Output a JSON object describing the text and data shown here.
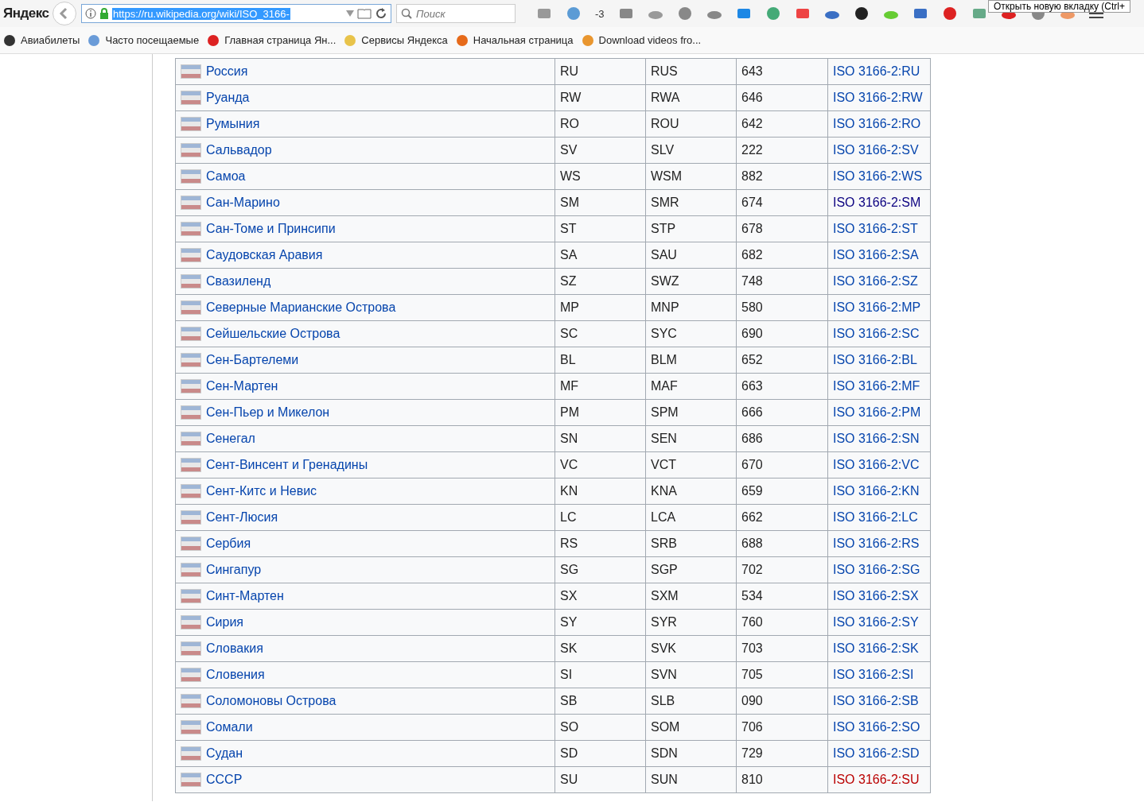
{
  "browser": {
    "logo": "Яндекс",
    "url": "https://ru.wikipedia.org/wiki/ISO_3166-",
    "search": {
      "placeholder": "Поиск"
    },
    "weather_badge": "-3",
    "tooltip": "Открыть новую вкладку (Ctrl+"
  },
  "bookmarks": [
    {
      "label": "Авиабилеты"
    },
    {
      "label": "Часто посещаемые"
    },
    {
      "label": "Главная страница Ян..."
    },
    {
      "label": "Сервисы Яндекса"
    },
    {
      "label": "Начальная страница"
    },
    {
      "label": "Download videos fro..."
    }
  ],
  "table": {
    "rows": [
      {
        "name": "Россия",
        "alpha2": "RU",
        "alpha3": "RUS",
        "numeric": "643",
        "iso": "ISO 3166-2:RU",
        "kind": "link"
      },
      {
        "name": "Руанда",
        "alpha2": "RW",
        "alpha3": "RWA",
        "numeric": "646",
        "iso": "ISO 3166-2:RW",
        "kind": "link"
      },
      {
        "name": "Румыния",
        "alpha2": "RO",
        "alpha3": "ROU",
        "numeric": "642",
        "iso": "ISO 3166-2:RO",
        "kind": "link"
      },
      {
        "name": "Сальвадор",
        "alpha2": "SV",
        "alpha3": "SLV",
        "numeric": "222",
        "iso": "ISO 3166-2:SV",
        "kind": "link"
      },
      {
        "name": "Самоа",
        "alpha2": "WS",
        "alpha3": "WSM",
        "numeric": "882",
        "iso": "ISO 3166-2:WS",
        "kind": "link"
      },
      {
        "name": "Сан-Марино",
        "alpha2": "SM",
        "alpha3": "SMR",
        "numeric": "674",
        "iso": "ISO 3166-2:SM",
        "kind": "visited"
      },
      {
        "name": "Сан-Томе и Принсипи",
        "alpha2": "ST",
        "alpha3": "STP",
        "numeric": "678",
        "iso": "ISO 3166-2:ST",
        "kind": "link"
      },
      {
        "name": "Саудовская Аравия",
        "alpha2": "SA",
        "alpha3": "SAU",
        "numeric": "682",
        "iso": "ISO 3166-2:SA",
        "kind": "link"
      },
      {
        "name": "Свазиленд",
        "alpha2": "SZ",
        "alpha3": "SWZ",
        "numeric": "748",
        "iso": "ISO 3166-2:SZ",
        "kind": "link"
      },
      {
        "name": "Северные Марианские Острова",
        "alpha2": "MP",
        "alpha3": "MNP",
        "numeric": "580",
        "iso": "ISO 3166-2:MP",
        "kind": "link"
      },
      {
        "name": "Сейшельские Острова",
        "alpha2": "SC",
        "alpha3": "SYC",
        "numeric": "690",
        "iso": "ISO 3166-2:SC",
        "kind": "link"
      },
      {
        "name": "Сен-Бартелеми",
        "alpha2": "BL",
        "alpha3": "BLM",
        "numeric": "652",
        "iso": "ISO 3166-2:BL",
        "kind": "link"
      },
      {
        "name": "Сен-Мартен",
        "alpha2": "MF",
        "alpha3": "MAF",
        "numeric": "663",
        "iso": "ISO 3166-2:MF",
        "kind": "link"
      },
      {
        "name": "Сен-Пьер и Микелон",
        "alpha2": "PM",
        "alpha3": "SPM",
        "numeric": "666",
        "iso": "ISO 3166-2:PM",
        "kind": "link"
      },
      {
        "name": "Сенегал",
        "alpha2": "SN",
        "alpha3": "SEN",
        "numeric": "686",
        "iso": "ISO 3166-2:SN",
        "kind": "link"
      },
      {
        "name": "Сент-Винсент и Гренадины",
        "alpha2": "VC",
        "alpha3": "VCT",
        "numeric": "670",
        "iso": "ISO 3166-2:VC",
        "kind": "link"
      },
      {
        "name": "Сент-Китс и Невис",
        "alpha2": "KN",
        "alpha3": "KNA",
        "numeric": "659",
        "iso": "ISO 3166-2:KN",
        "kind": "link"
      },
      {
        "name": "Сент-Люсия",
        "alpha2": "LC",
        "alpha3": "LCA",
        "numeric": "662",
        "iso": "ISO 3166-2:LC",
        "kind": "link"
      },
      {
        "name": "Сербия",
        "alpha2": "RS",
        "alpha3": "SRB",
        "numeric": "688",
        "iso": "ISO 3166-2:RS",
        "kind": "link"
      },
      {
        "name": "Сингапур",
        "alpha2": "SG",
        "alpha3": "SGP",
        "numeric": "702",
        "iso": "ISO 3166-2:SG",
        "kind": "link"
      },
      {
        "name": "Синт-Мартен",
        "alpha2": "SX",
        "alpha3": "SXM",
        "numeric": "534",
        "iso": "ISO 3166-2:SX",
        "kind": "link"
      },
      {
        "name": "Сирия",
        "alpha2": "SY",
        "alpha3": "SYR",
        "numeric": "760",
        "iso": "ISO 3166-2:SY",
        "kind": "link"
      },
      {
        "name": "Словакия",
        "alpha2": "SK",
        "alpha3": "SVK",
        "numeric": "703",
        "iso": "ISO 3166-2:SK",
        "kind": "link"
      },
      {
        "name": "Словения",
        "alpha2": "SI",
        "alpha3": "SVN",
        "numeric": "705",
        "iso": "ISO 3166-2:SI",
        "kind": "link"
      },
      {
        "name": "Соломоновы Острова",
        "alpha2": "SB",
        "alpha3": "SLB",
        "numeric": "090",
        "iso": "ISO 3166-2:SB",
        "kind": "link"
      },
      {
        "name": "Сомали",
        "alpha2": "SO",
        "alpha3": "SOM",
        "numeric": "706",
        "iso": "ISO 3166-2:SO",
        "kind": "link"
      },
      {
        "name": "Судан",
        "alpha2": "SD",
        "alpha3": "SDN",
        "numeric": "729",
        "iso": "ISO 3166-2:SD",
        "kind": "link"
      },
      {
        "name": "СССР",
        "alpha2": "SU",
        "alpha3": "SUN",
        "numeric": "810",
        "iso": "ISO 3166-2:SU",
        "kind": "new"
      }
    ]
  }
}
